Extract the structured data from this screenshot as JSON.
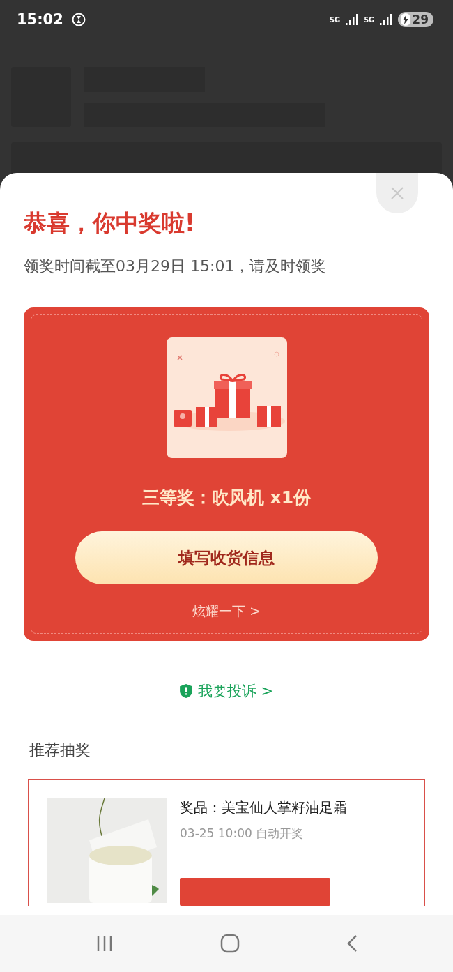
{
  "status_bar": {
    "time": "15:02",
    "network_1": "5G",
    "network_2": "5G",
    "battery": "29",
    "charging": true
  },
  "prize_sheet": {
    "title": "恭喜，你中奖啦!",
    "deadline": "领奖时间截至03月29日 15:01，请及时领奖",
    "prize_card": {
      "prize": "三等奖：吹风机 x1份",
      "claim_button": "填写收货信息",
      "share_link": "炫耀一下 >"
    },
    "complaint_link": "我要投诉 >",
    "recommended": {
      "heading": "推荐抽奖",
      "items": [
        {
          "kind": "picture",
          "name": "奖品：美宝仙人掌籽油足霜",
          "draw_time": "03-25 10:00 自动开奖"
        }
      ]
    }
  }
}
